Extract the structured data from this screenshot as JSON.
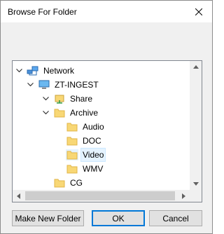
{
  "window": {
    "title": "Browse For Folder"
  },
  "tree": {
    "items": [
      {
        "label": "Network",
        "icon": "network-icon",
        "expanded": true
      },
      {
        "label": "ZT-INGEST",
        "icon": "computer-icon",
        "expanded": true
      },
      {
        "label": "Share",
        "icon": "shared-folder-icon",
        "expanded": false
      },
      {
        "label": "Archive",
        "icon": "folder-icon",
        "expanded": true
      },
      {
        "label": "Audio",
        "icon": "folder-icon"
      },
      {
        "label": "DOC",
        "icon": "folder-icon"
      },
      {
        "label": "Video",
        "icon": "folder-icon",
        "selected": true
      },
      {
        "label": "WMV",
        "icon": "folder-icon"
      },
      {
        "label": "CG",
        "icon": "folder-icon"
      }
    ]
  },
  "buttons": {
    "new_folder": "Make New Folder",
    "ok": "OK",
    "cancel": "Cancel"
  },
  "colors": {
    "folder": "#f8d775",
    "selection": "#e5f3ff",
    "accent": "#0078d7"
  }
}
